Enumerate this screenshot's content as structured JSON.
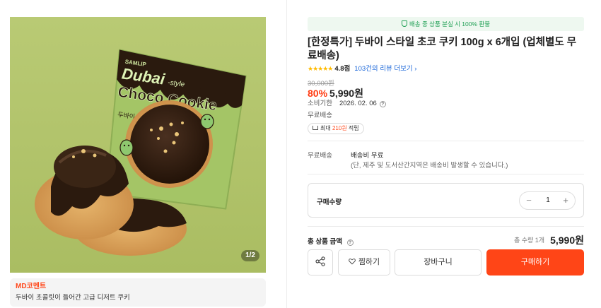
{
  "gallery": {
    "pager": "1/2",
    "package": {
      "brand": "SAMLIP",
      "line1": "Dubai",
      "style": "-style",
      "line2": "Choco Cookie",
      "korean": "두바이 초코쿠키"
    },
    "colors": {
      "background": "#b3c56d",
      "package": "#a8c86a",
      "chocolate": "#3b2618",
      "cookie": "#d7a15c"
    }
  },
  "md_comment": {
    "title": "MD코멘트",
    "text": "두바이 초콜릿이 들어간 고급 디저트 쿠키"
  },
  "promo_banner": "배송 중 상품 분실 시 100% 환불",
  "product": {
    "title": "[한정특가] 두바이 스타일 초코 쿠키 100g x 6개입 (업체별도 무료배송)",
    "rating_score": "4.8점",
    "stars": "★★★★★",
    "review_link": "103건의 리뷰 더보기",
    "original_price": "30,000원",
    "discount_rate": "80%",
    "sale_price": "5,990원",
    "expiry_label": "소비기한",
    "expiry_date": "2026. 02. 06",
    "shipping_tag": "무료배송",
    "points_prefix": "최대",
    "points_amount": "210원",
    "points_suffix": "적립"
  },
  "shipping": {
    "label": "무료배송",
    "value": "배송비 무료",
    "note": "(단, 제주 및 도서산간지역은 배송비 발생할 수 있습니다.)"
  },
  "quantity": {
    "label": "구매수량",
    "value": "1",
    "minus": "−",
    "plus": "+"
  },
  "total": {
    "label": "총 상품 금액",
    "count": "총 수량 1개",
    "price": "5,990원"
  },
  "buttons": {
    "like": "찜하기",
    "cart": "장바구니",
    "buy": "구매하기"
  },
  "colors": {
    "accent": "#ff4517",
    "discount": "#ff3b12",
    "link": "#1a66d9",
    "promo_green": "#1f9f54"
  }
}
